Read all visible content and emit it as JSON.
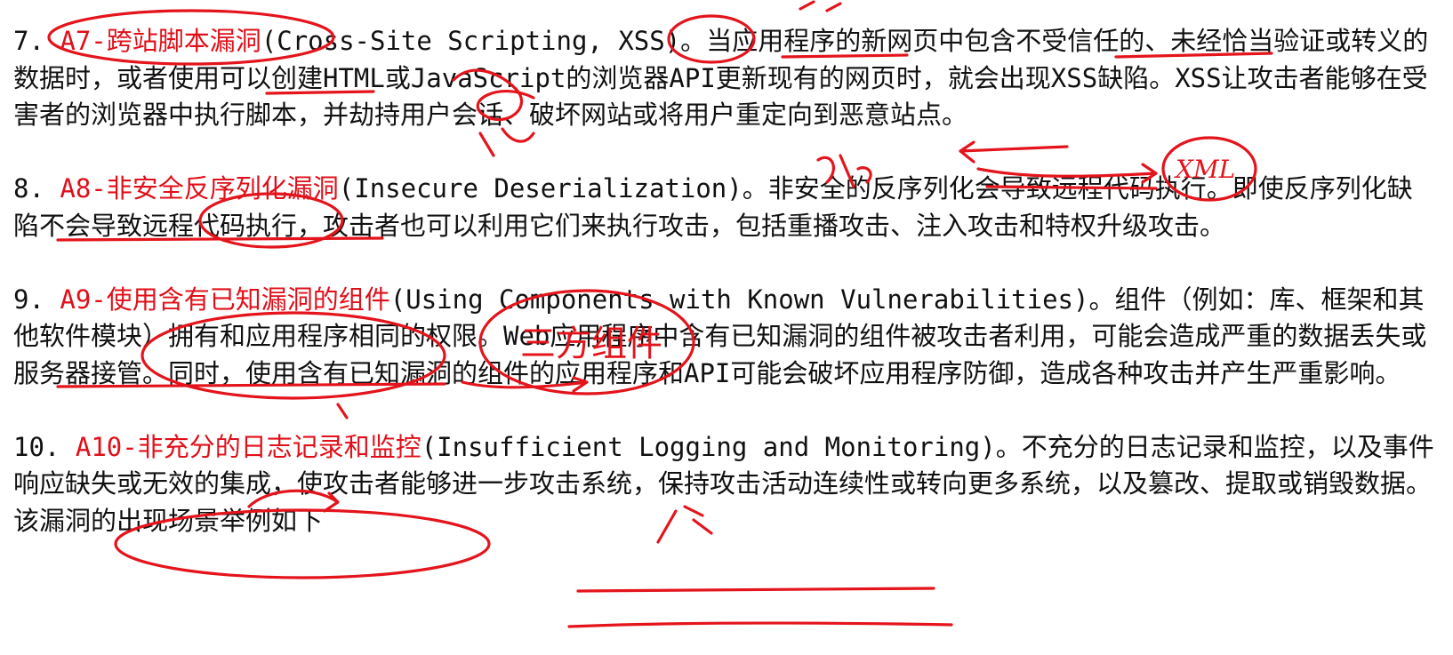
{
  "items": [
    {
      "number": "7.",
      "title": "A7-跨站脚本漏洞",
      "english": "(Cross-Site Scripting, XSS)。",
      "body": "当应用程序的新网页中包含不受信任的、未经恰当验证或转义的数据时，或者使用可以创建HTML或JavaScript的浏览器API更新现有的网页时，就会出现XSS缺陷。XSS让攻击者能够在受害者的浏览器中执行脚本，并劫持用户会话、破坏网站或将用户重定向到恶意站点。"
    },
    {
      "number": "8.",
      "title": "A8-非安全反序列化漏洞",
      "english": "(Insecure Deserialization)。",
      "body": "非安全的反序列化会导致远程代码执行。即使反序列化缺陷不会导致远程代码执行，攻击者也可以利用它们来执行攻击，包括重播攻击、注入攻击和特权升级攻击。"
    },
    {
      "number": "9.",
      "title": "A9-使用含有已知漏洞的组件",
      "english": "(Using Components with Known Vulnerabilities)。",
      "body": "组件（例如：库、框架和其他软件模块）拥有和应用程序相同的权限。Web应用程序中含有已知漏洞的组件被攻击者利用，可能会造成严重的数据丢失或服务器接管。同时，使用含有已知漏洞的组件的应用程序和API可能会破坏应用程序防御，造成各种攻击并产生严重影响。"
    },
    {
      "number": "10.",
      "title": "A10-非充分的日志记录和监控",
      "english": "(Insufficient Logging and Monitoring)。",
      "body": "不充分的日志记录和监控，以及事件响应缺失或无效的集成，使攻击者能够进一步攻击系统，保持攻击活动连续性或转向更多系统，以及篡改、提取或销毁数据。该漏洞的出现场景举例如下"
    }
  ],
  "annotations": {
    "a9_note": "三方组件",
    "xml_note": "XML",
    "ink_color": "#e4141c",
    "title_color": "#e0101a"
  }
}
